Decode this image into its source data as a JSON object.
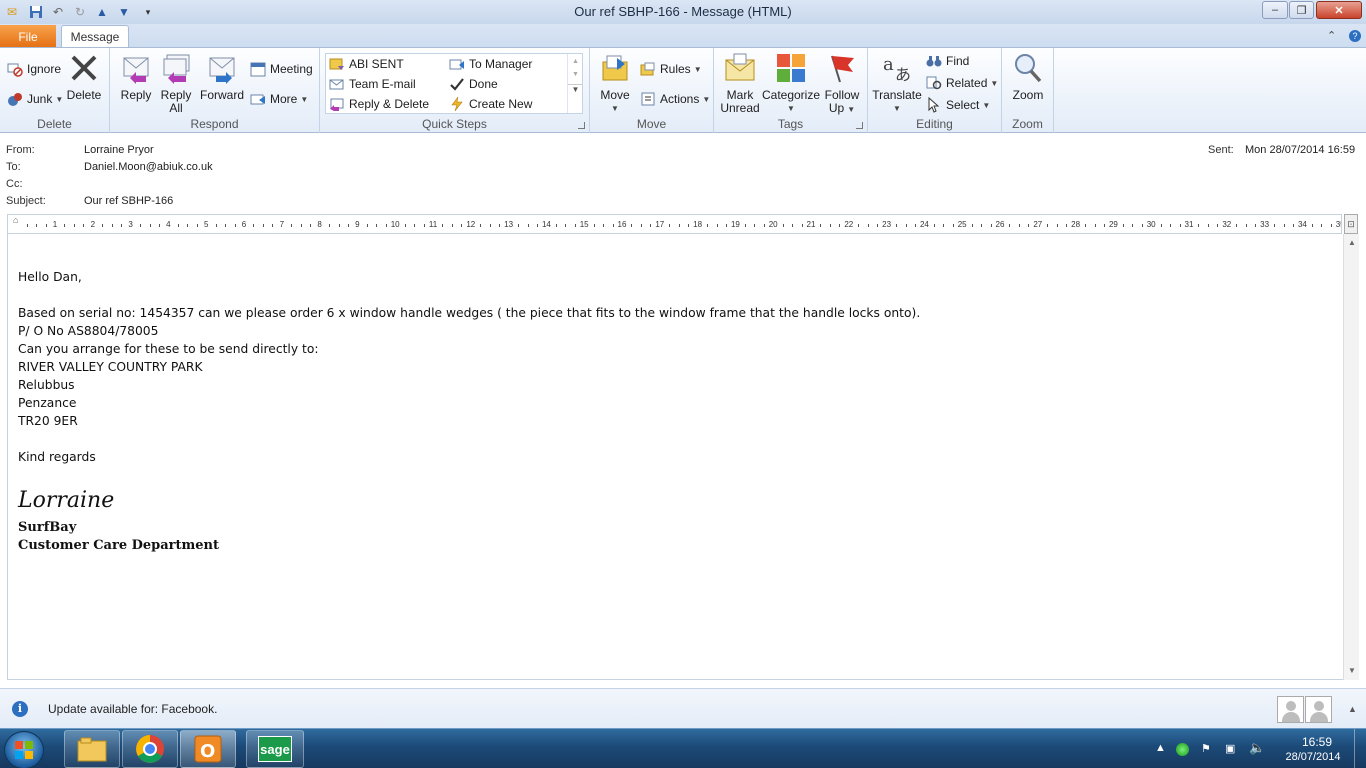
{
  "window": {
    "title": "Our ref SBHP-166  -  Message (HTML)",
    "controls": {
      "minimize": "–",
      "maximize": "❐",
      "close": "✕"
    }
  },
  "quick_access": [
    "save-icon",
    "undo-icon",
    "redo-icon",
    "previous-item-icon",
    "next-item-icon",
    "customize-icon"
  ],
  "tabs": {
    "file": "File",
    "message": "Message"
  },
  "ribbon": {
    "delete_group": {
      "label": "Delete",
      "ignore": "Ignore",
      "junk": "Junk",
      "delete": "Delete"
    },
    "respond_group": {
      "label": "Respond",
      "reply": "Reply",
      "reply_all_1": "Reply",
      "reply_all_2": "All",
      "forward": "Forward",
      "meeting": "Meeting",
      "more": "More"
    },
    "quick_steps_group": {
      "label": "Quick Steps",
      "items": [
        "ABI SENT",
        "To Manager",
        "Team E-mail",
        "Done",
        "Reply & Delete",
        "Create New"
      ]
    },
    "move_group": {
      "label": "Move",
      "move": "Move",
      "rules": "Rules",
      "actions": "Actions"
    },
    "tags_group": {
      "label": "Tags",
      "mark_unread_1": "Mark",
      "mark_unread_2": "Unread",
      "categorize": "Categorize",
      "follow_up_1": "Follow",
      "follow_up_2": "Up"
    },
    "editing_group": {
      "label": "Editing",
      "translate": "Translate",
      "find": "Find",
      "related": "Related",
      "select": "Select"
    },
    "zoom_group": {
      "label": "Zoom",
      "zoom": "Zoom"
    }
  },
  "header": {
    "from_label": "From:",
    "from": "Lorraine Pryor",
    "to_label": "To:",
    "to": "Daniel.Moon@abiuk.co.uk",
    "cc_label": "Cc:",
    "cc": "",
    "subject_label": "Subject:",
    "subject": "Our ref SBHP-166",
    "sent_label": "Sent:",
    "sent": "Mon 28/07/2014 16:59"
  },
  "ruler_ticks": [
    "1",
    "2",
    "3",
    "4",
    "5",
    "6",
    "7",
    "8",
    "9",
    "10",
    "11",
    "12",
    "13",
    "14",
    "15",
    "16",
    "17",
    "18",
    "19",
    "20",
    "21",
    "22",
    "23",
    "24",
    "25",
    "26",
    "27",
    "28",
    "29",
    "30",
    "31",
    "32",
    "33",
    "34",
    "35"
  ],
  "body": {
    "greeting": "Hello Dan,",
    "line1": "Based on serial no: 1454357 can we please order 6 x window handle wedges ( the piece that fits to the window frame that the handle locks onto).",
    "line2": "P/ O No AS8804/78005",
    "line3": "Can you arrange for these to be send directly to:",
    "addr1": "RIVER VALLEY COUNTRY PARK",
    "addr2": "Relubbus",
    "addr3": "Penzance",
    "addr4": "TR20 9ER",
    "closing": "Kind regards",
    "signature_name": "Lorraine",
    "sig_company": "SurfBay",
    "sig_dept": "Customer Care Department"
  },
  "people_pane": {
    "update_text": "Update available for: Facebook."
  },
  "taskbar": {
    "apps": [
      "file-explorer-icon",
      "chrome-icon",
      "outlook-icon",
      "sage-icon"
    ],
    "sage_label": "sage",
    "clock_time": "16:59",
    "clock_date": "28/07/2014"
  },
  "colors": {
    "accent_file": "#e46e12",
    "ribbon_bg": "#e3ecf8",
    "taskbar": "#1c4a78"
  }
}
